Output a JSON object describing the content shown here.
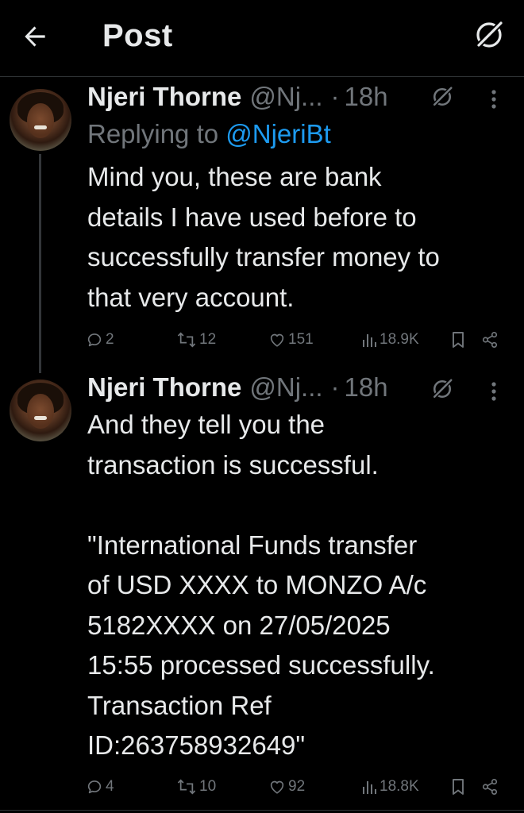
{
  "header": {
    "title": "Post",
    "back_icon": "arrow-left-icon",
    "grok_icon": "grok-icon"
  },
  "tweets": [
    {
      "name": "Njeri Thorne",
      "handle": "@Nj...",
      "dot": "·",
      "time": "18h",
      "replying_label": "Replying to ",
      "replying_handle": "@NjeriBt",
      "text_lines": [
        "Mind you, these are bank",
        "details I have used before to",
        "successfully transfer money to",
        "that very account."
      ],
      "replies": "2",
      "reposts": "12",
      "likes": "151",
      "views": "18.9K"
    },
    {
      "name": "Njeri Thorne",
      "handle": "@Nj...",
      "dot": "·",
      "time": "18h",
      "text_lines": [
        "And they tell you the",
        "transaction is successful.",
        "",
        "\"International Funds transfer",
        "of USD XXXX to MONZO A/c",
        "5182XXXX on 27/05/2025",
        "15:55 processed successfully.",
        "Transaction Ref",
        "ID:263758932649\""
      ],
      "replies": "4",
      "reposts": "10",
      "likes": "92",
      "views": "18.8K"
    }
  ],
  "colors": {
    "background": "#000000",
    "text": "#e7e9ea",
    "secondary": "#71767b",
    "accent": "#1d9bf0",
    "divider": "#2f3336"
  }
}
